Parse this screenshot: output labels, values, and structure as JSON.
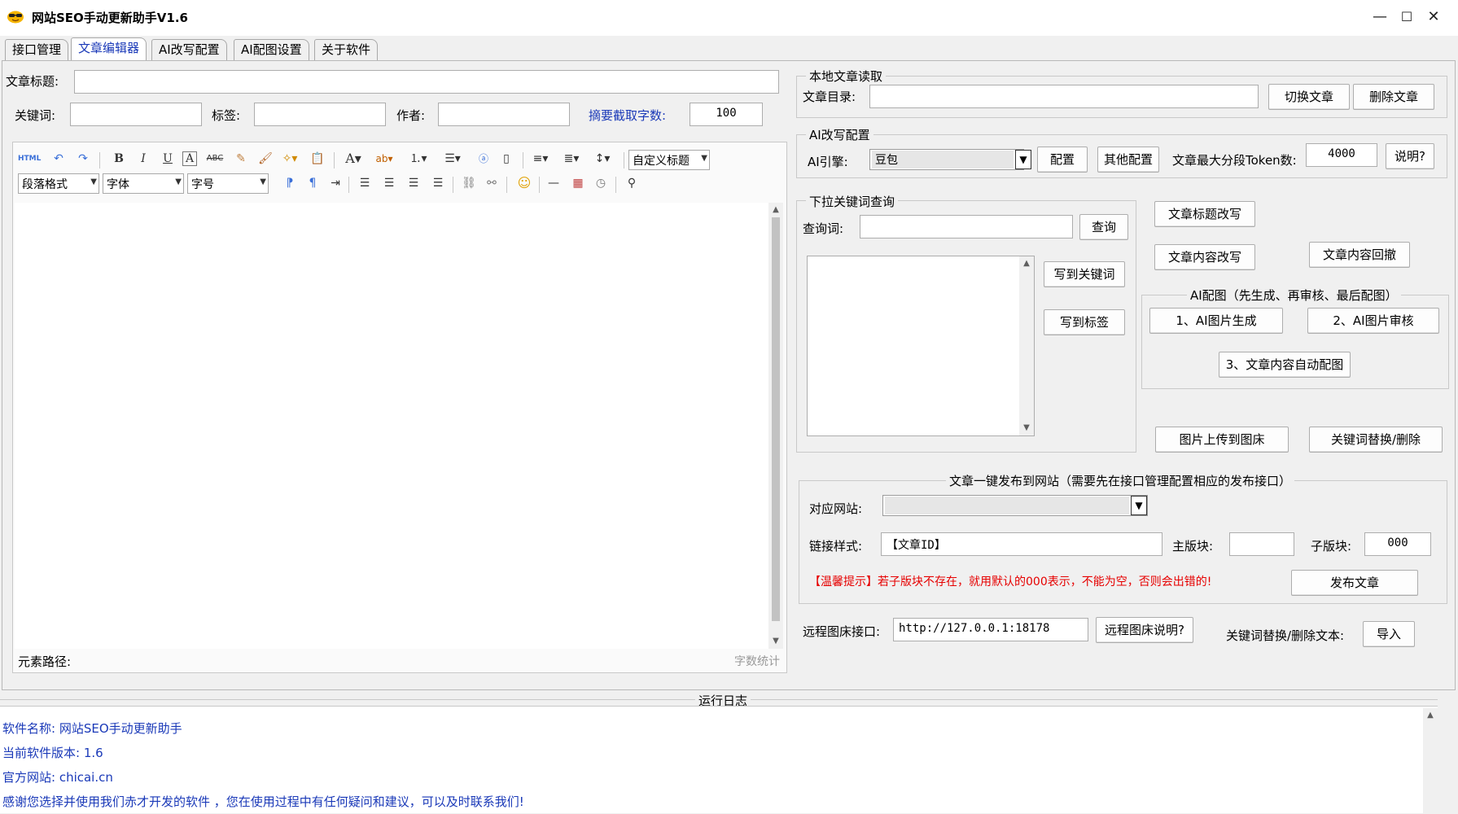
{
  "window": {
    "title": "网站SEO手动更新助手V1.6",
    "minimize": "—",
    "maximize": "☐",
    "close": "✕"
  },
  "tabs": [
    "接口管理",
    "文章编辑器",
    "AI改写配置",
    "AI配图设置",
    "关于软件"
  ],
  "article": {
    "title_label": "文章标题:",
    "title_value": "",
    "keywords_label": "关键词:",
    "tags_label": "标签:",
    "author_label": "作者:",
    "summary_label": "摘要截取字数:",
    "summary_value": "100"
  },
  "editor": {
    "html_label": "HTML",
    "custom_heading": "自定义标题",
    "paragraph_format": "段落格式",
    "font_family": "字体",
    "font_size": "字号",
    "element_path_label": "元素路径:",
    "word_count_label": "字数统计"
  },
  "local_read": {
    "group_title": "本地文章读取",
    "dir_label": "文章目录:",
    "dir_value": "",
    "switch_button": "切换文章",
    "delete_button": "删除文章"
  },
  "ai_rewrite": {
    "group_title": "AI改写配置",
    "engine_label": "AI引擎:",
    "engine_value": "豆包",
    "config_button": "配置",
    "other_config_button": "其他配置",
    "token_label": "文章最大分段Token数:",
    "token_value": "4000",
    "help_button": "说明?"
  },
  "keyword_query": {
    "group_title": "下拉关键词查询",
    "query_label": "查询词:",
    "query_button": "查询",
    "write_keywords_button": "写到关键词",
    "write_tags_button": "写到标签"
  },
  "ai_actions": {
    "title_rewrite": "文章标题改写",
    "content_rewrite": "文章内容改写",
    "content_revert": "文章内容回撤"
  },
  "ai_image": {
    "group_title": "AI配图（先生成、再审核、最后配图）",
    "generate": "1、AI图片生成",
    "review": "2、AI图片审核",
    "auto_insert": "3、文章内容自动配图"
  },
  "image_actions": {
    "upload": "图片上传到图床",
    "keyword_replace": "关键词替换/删除"
  },
  "publish": {
    "group_title": "文章一键发布到网站（需要先在接口管理配置相应的发布接口）",
    "site_label": "对应网站:",
    "site_value": "",
    "link_label": "链接样式:",
    "link_value": "【文章ID】",
    "main_board_label": "主版块:",
    "main_board_value": "",
    "sub_board_label": "子版块:",
    "sub_board_value": "000",
    "warning": "【温馨提示】若子版块不存在，就用默认的000表示，不能为空，否则会出错的!",
    "publish_button": "发布文章"
  },
  "remote": {
    "label": "远程图床接口:",
    "value": "http://127.0.0.1:18178",
    "help_button": "远程图床说明?",
    "replace_label": "关键词替换/删除文本:",
    "import_button": "导入"
  },
  "log": {
    "title": "运行日志",
    "lines": [
      "软件名称: 网站SEO手动更新助手",
      "当前软件版本: 1.6",
      "官方网站: chicai.cn",
      "感谢您选择并使用我们赤才开发的软件 ，您在使用过程中有任何疑问和建议，可以及时联系我们!"
    ]
  }
}
